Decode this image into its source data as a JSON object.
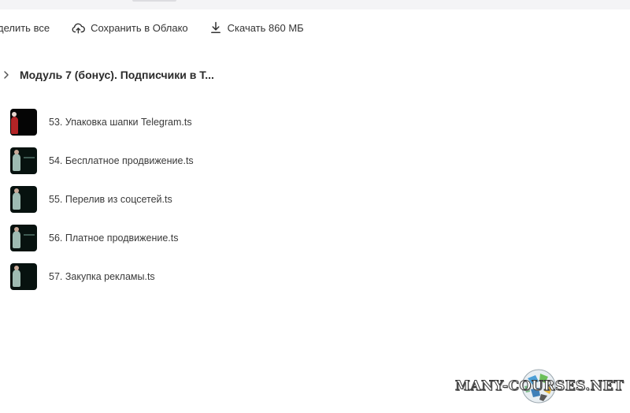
{
  "toolbar": {
    "select_all_label": "делить все",
    "save_to_cloud_label": "Сохранить в Облако",
    "download_label": "Скачать 860 МБ"
  },
  "folder": {
    "title": "Модуль 7 (бонус). Подписчики в Т..."
  },
  "files": [
    {
      "name": "53. Упаковка шапки Telegram.ts",
      "thumb": "dark"
    },
    {
      "name": "54. Бесплатное продвижение.ts",
      "thumb": "green"
    },
    {
      "name": "55. Перелив из соцсетей.ts",
      "thumb": "green"
    },
    {
      "name": "56. Платное продвижение.ts",
      "thumb": "green"
    },
    {
      "name": "57. Закупка рекламы.ts",
      "thumb": "green"
    }
  ],
  "watermark": {
    "text": "MANY-COURSES.NET"
  },
  "icons": {
    "cloud": "cloud-upload-icon",
    "download": "download-icon",
    "chevron": "chevron-right-icon"
  }
}
